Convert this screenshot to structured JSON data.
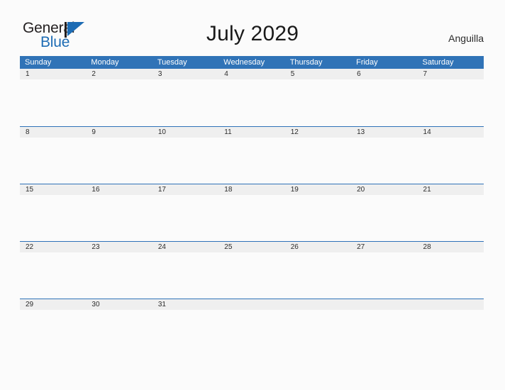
{
  "branding": {
    "name_part1": "General",
    "name_part2": "Blue",
    "flag_icon": "triangle-flag-icon",
    "accent_color": "#1d6cb4"
  },
  "header": {
    "title": "July 2029",
    "location": "Anguilla"
  },
  "colors": {
    "header_blue": "#3073b7",
    "row_divider_blue": "#2e72b8",
    "date_band_gray": "#efefef",
    "page_background": "#fbfbfb",
    "text_dark": "#2b2b2b"
  },
  "calendar": {
    "weekdays": [
      "Sunday",
      "Monday",
      "Tuesday",
      "Wednesday",
      "Thursday",
      "Friday",
      "Saturday"
    ],
    "weeks": [
      [
        "1",
        "2",
        "3",
        "4",
        "5",
        "6",
        "7"
      ],
      [
        "8",
        "9",
        "10",
        "11",
        "12",
        "13",
        "14"
      ],
      [
        "15",
        "16",
        "17",
        "18",
        "19",
        "20",
        "21"
      ],
      [
        "22",
        "23",
        "24",
        "25",
        "26",
        "27",
        "28"
      ],
      [
        "29",
        "30",
        "31",
        "",
        "",
        "",
        ""
      ]
    ]
  }
}
